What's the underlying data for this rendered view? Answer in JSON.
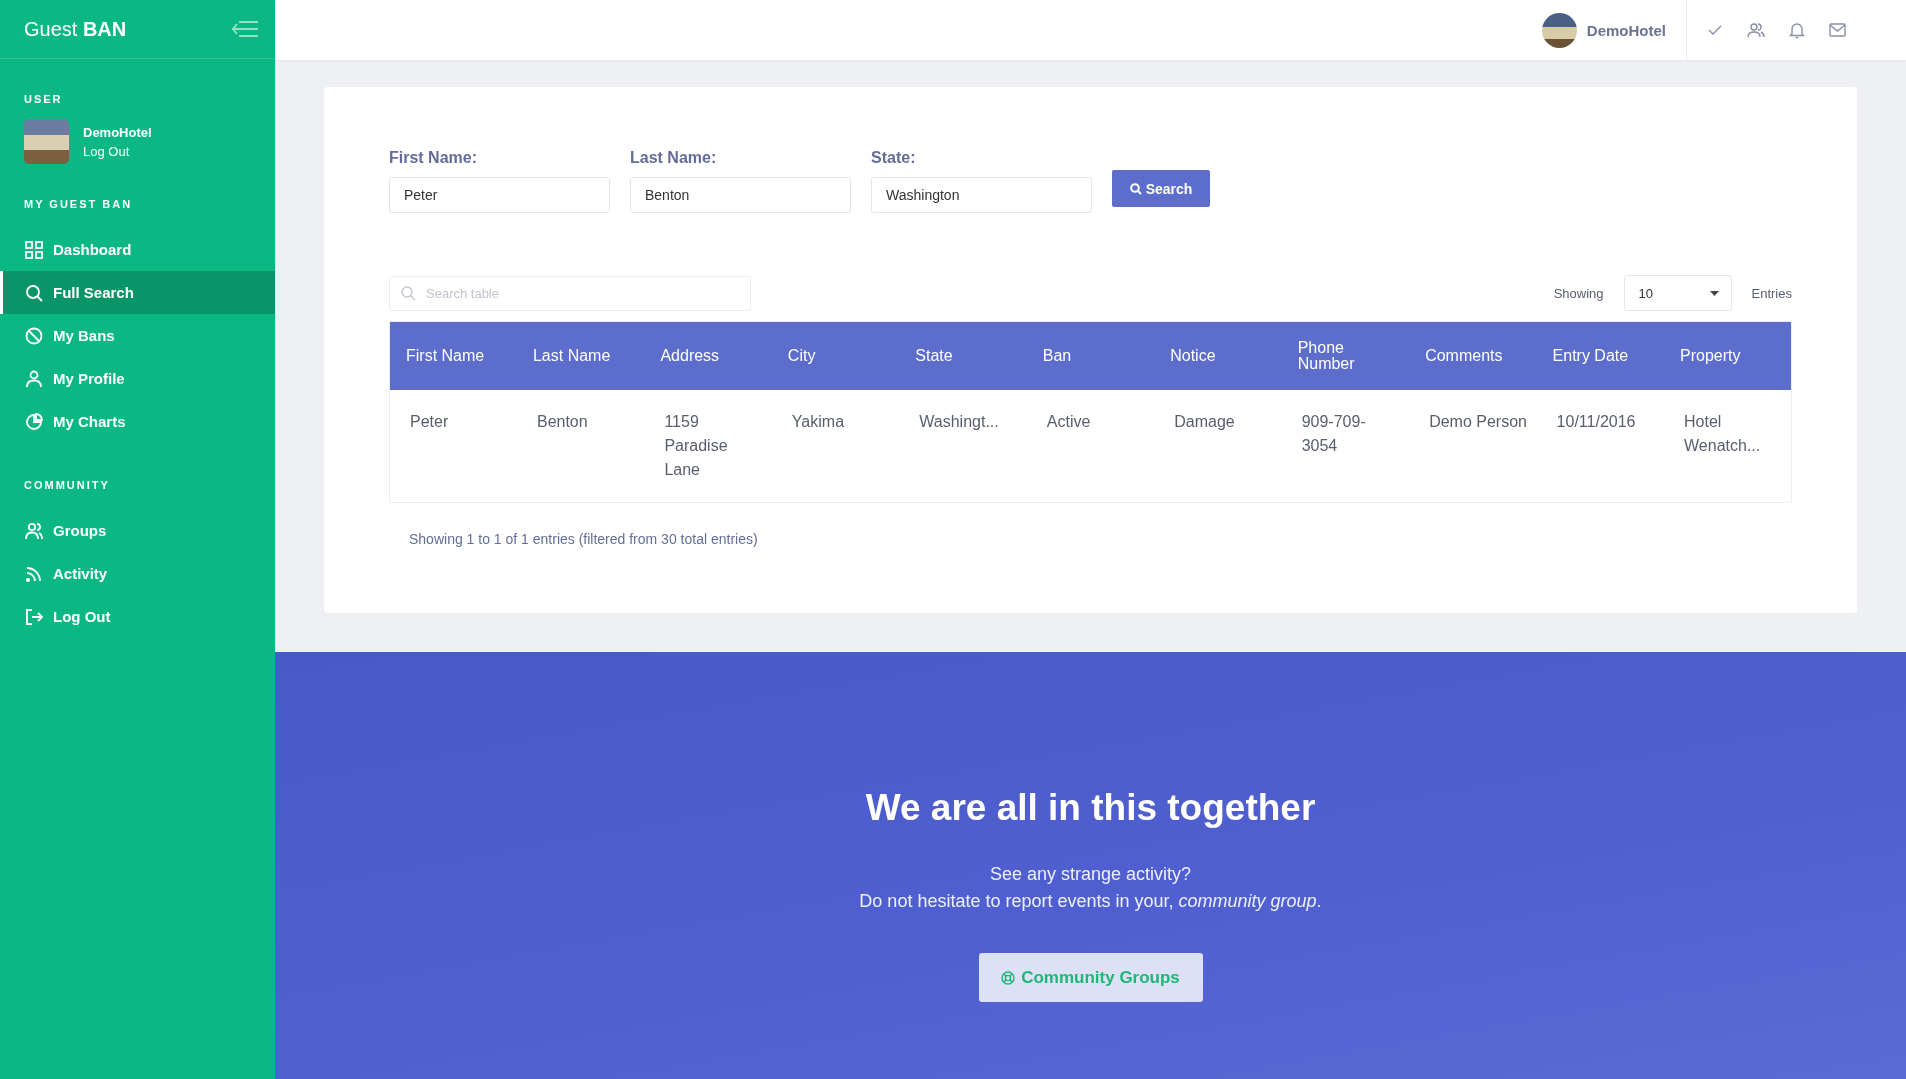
{
  "sidebar": {
    "brand": {
      "light": "Guest",
      "bold": "BAN"
    },
    "user_heading": "USER",
    "user": {
      "name": "DemoHotel",
      "link": "Log Out"
    },
    "sections": [
      {
        "heading": "MY GUEST BAN",
        "items": [
          {
            "label": "Dashboard",
            "selected": false
          },
          {
            "label": "Full Search",
            "selected": true
          },
          {
            "label": "My Bans",
            "selected": false
          },
          {
            "label": "My Profile",
            "selected": false
          },
          {
            "label": "My Charts",
            "selected": false
          }
        ]
      },
      {
        "heading": "COMMUNITY",
        "items": [
          {
            "label": "Groups",
            "selected": false
          },
          {
            "label": "Activity",
            "selected": false
          },
          {
            "label": "Log Out",
            "selected": false
          }
        ]
      }
    ]
  },
  "topbar": {
    "user": "DemoHotel"
  },
  "search_form": {
    "fields": [
      {
        "label": "First Name:",
        "value": "Peter"
      },
      {
        "label": "Last Name:",
        "value": "Benton"
      },
      {
        "label": "State:",
        "value": "Washington"
      }
    ],
    "button": "Search"
  },
  "table": {
    "search": {
      "placeholder": "Search table"
    },
    "showing_label": "Showing",
    "page_size": "10",
    "entries_label": "Entries",
    "columns": [
      "First Name",
      "Last Name",
      "Address",
      "City",
      "State",
      "Ban",
      "Notice",
      "Phone Number",
      "Comments",
      "Entry Date",
      "Property"
    ],
    "rows": [
      [
        "Peter",
        "Benton",
        "1159 Paradise Lane",
        "Yakima",
        "Washingt...",
        "Active",
        "Damage",
        "909-709-3054",
        "Demo Person",
        "10/11/2016",
        "Hotel Wenatch..."
      ]
    ],
    "info": "Showing 1 to 1 of 1 entries (filtered from 30 total entries)"
  },
  "banner": {
    "title": "We are all in this together",
    "line_1": "See any strange activity?",
    "line_2": "Do not hesitate to report events in your, *community group*.",
    "button": "Community Groups"
  }
}
